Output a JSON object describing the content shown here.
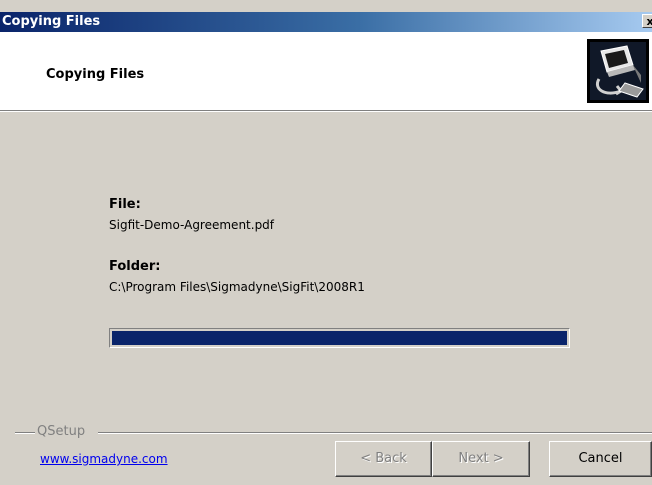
{
  "window": {
    "title": "Copying Files",
    "close_label": "x"
  },
  "header": {
    "title": "Copying Files",
    "icon": "setup-computer-icon"
  },
  "file": {
    "label": "File:",
    "value": "Sigfit-Demo-Agreement.pdf"
  },
  "folder": {
    "label": "Folder:",
    "value": "C:\\Program Files\\Sigmadyne\\SigFit\\2008R1"
  },
  "progress": {
    "fraction": 1.0
  },
  "footer": {
    "group_label": "QSetup",
    "link": "www.sigmadyne.com",
    "back_label": "< Back",
    "next_label": "Next >",
    "cancel_label": "Cancel"
  },
  "colors": {
    "title_bar_start": "#0a246a",
    "title_bar_end": "#a6caf0",
    "progress_fill": "#0a246a",
    "dialog_face": "#d4d0c8"
  }
}
